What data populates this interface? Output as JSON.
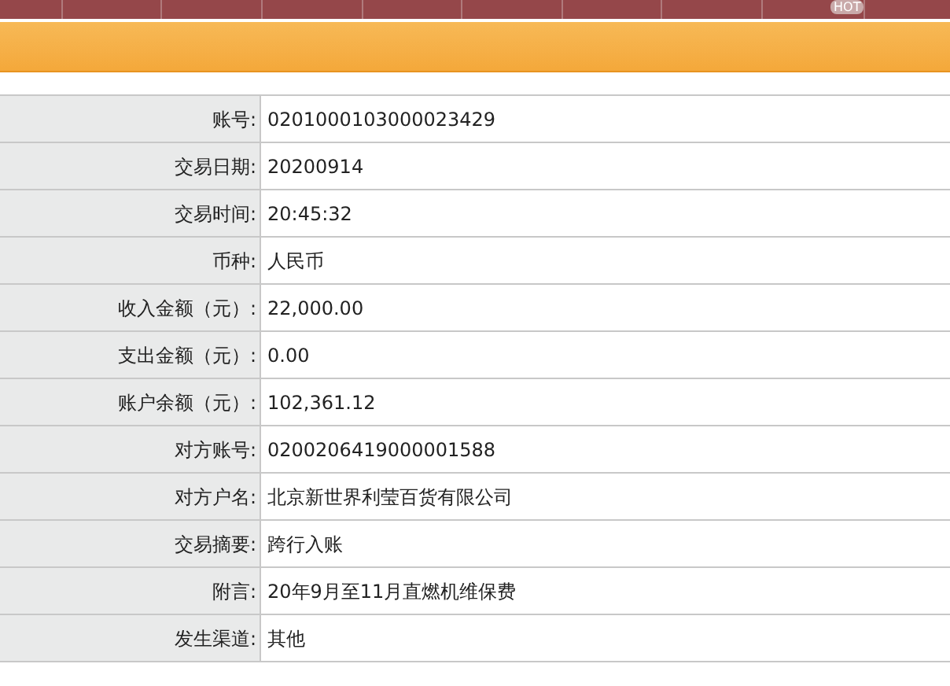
{
  "nav": {
    "badge": "HOT"
  },
  "details": [
    {
      "label": "账号:",
      "value": "0201000103000023429"
    },
    {
      "label": "交易日期:",
      "value": "20200914"
    },
    {
      "label": "交易时间:",
      "value": "20:45:32"
    },
    {
      "label": "币种:",
      "value": "人民币"
    },
    {
      "label": "收入金额（元）:",
      "value": "22,000.00"
    },
    {
      "label": "支出金额（元）:",
      "value": "0.00"
    },
    {
      "label": "账户余额（元）:",
      "value": "102,361.12"
    },
    {
      "label": "对方账号:",
      "value": "0200206419000001588"
    },
    {
      "label": "对方户名:",
      "value": "北京新世界利莹百货有限公司"
    },
    {
      "label": "交易摘要:",
      "value": "跨行入账"
    },
    {
      "label": "附言:",
      "value": "20年9月至11月直燃机维保费"
    },
    {
      "label": "发生渠道:",
      "value": "其他"
    }
  ]
}
